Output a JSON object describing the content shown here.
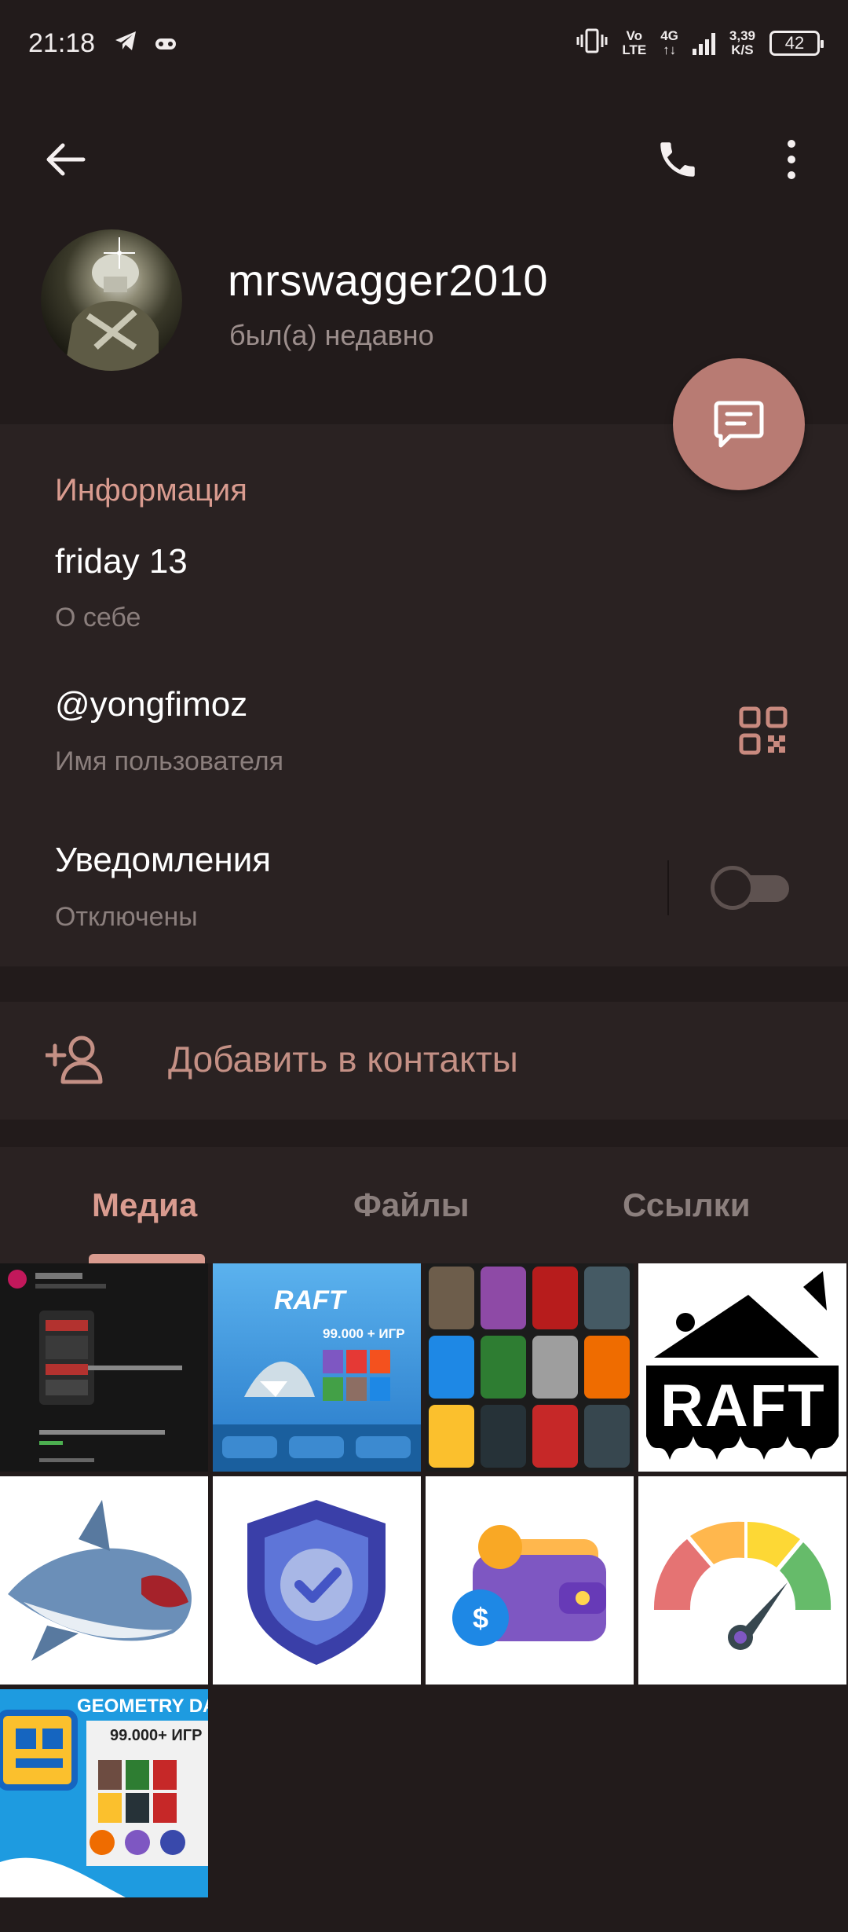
{
  "status_bar": {
    "time": "21:18",
    "network_top": "Vo",
    "network_bottom": "LTE",
    "gen": "4G",
    "speed_top": "3,39",
    "speed_bottom": "K/S",
    "battery": "42"
  },
  "profile": {
    "name": "mrswagger2010",
    "status": "был(а) недавно"
  },
  "info": {
    "section_title": "Информация",
    "bio_value": "friday 13",
    "bio_label": "О себе",
    "username_value": "@yongfimoz",
    "username_label": "Имя пользователя",
    "notifications_value": "Уведомления",
    "notifications_label": "Отключены",
    "notifications_enabled": false
  },
  "actions": {
    "add_contact": "Добавить в контакты"
  },
  "tabs": {
    "media": "Медиа",
    "files": "Файлы",
    "links": "Ссылки",
    "active": "media"
  },
  "media": {
    "raft_title": "RAFT",
    "raft_promo": "99.000 + ИГР",
    "raft_logo_text": "RAFT",
    "gd_title": "GEOMETRY DA",
    "gd_promo": "99.000+ ИГР"
  },
  "colors": {
    "accent": "#d99b8f",
    "fab": "#b87b73",
    "background": "#221b1b",
    "card": "#2a2222"
  }
}
